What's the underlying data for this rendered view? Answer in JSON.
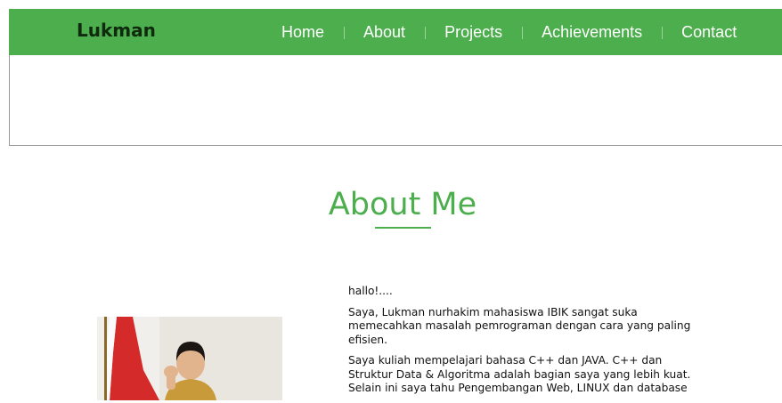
{
  "header": {
    "brand": "Lukman",
    "nav": [
      "Home",
      "About",
      "Projects",
      "Achievements",
      "Contact"
    ]
  },
  "about": {
    "title": "About Me",
    "paragraphs": [
      "hallo!....",
      "Saya, Lukman nurhakim mahasiswa IBIK sangat suka memecahkan masalah pemrograman dengan cara yang paling efisien.",
      "Saya kuliah mempelajari bahasa C++ dan JAVA. C++ dan Struktur Data & Algoritma adalah bagian saya yang lebih kuat. Selain ini saya tahu Pengembangan Web, LINUX dan database"
    ]
  },
  "colors": {
    "accent": "#4cae4c",
    "nav_text": "#ffffff",
    "brand_text": "#0f2a0f"
  }
}
